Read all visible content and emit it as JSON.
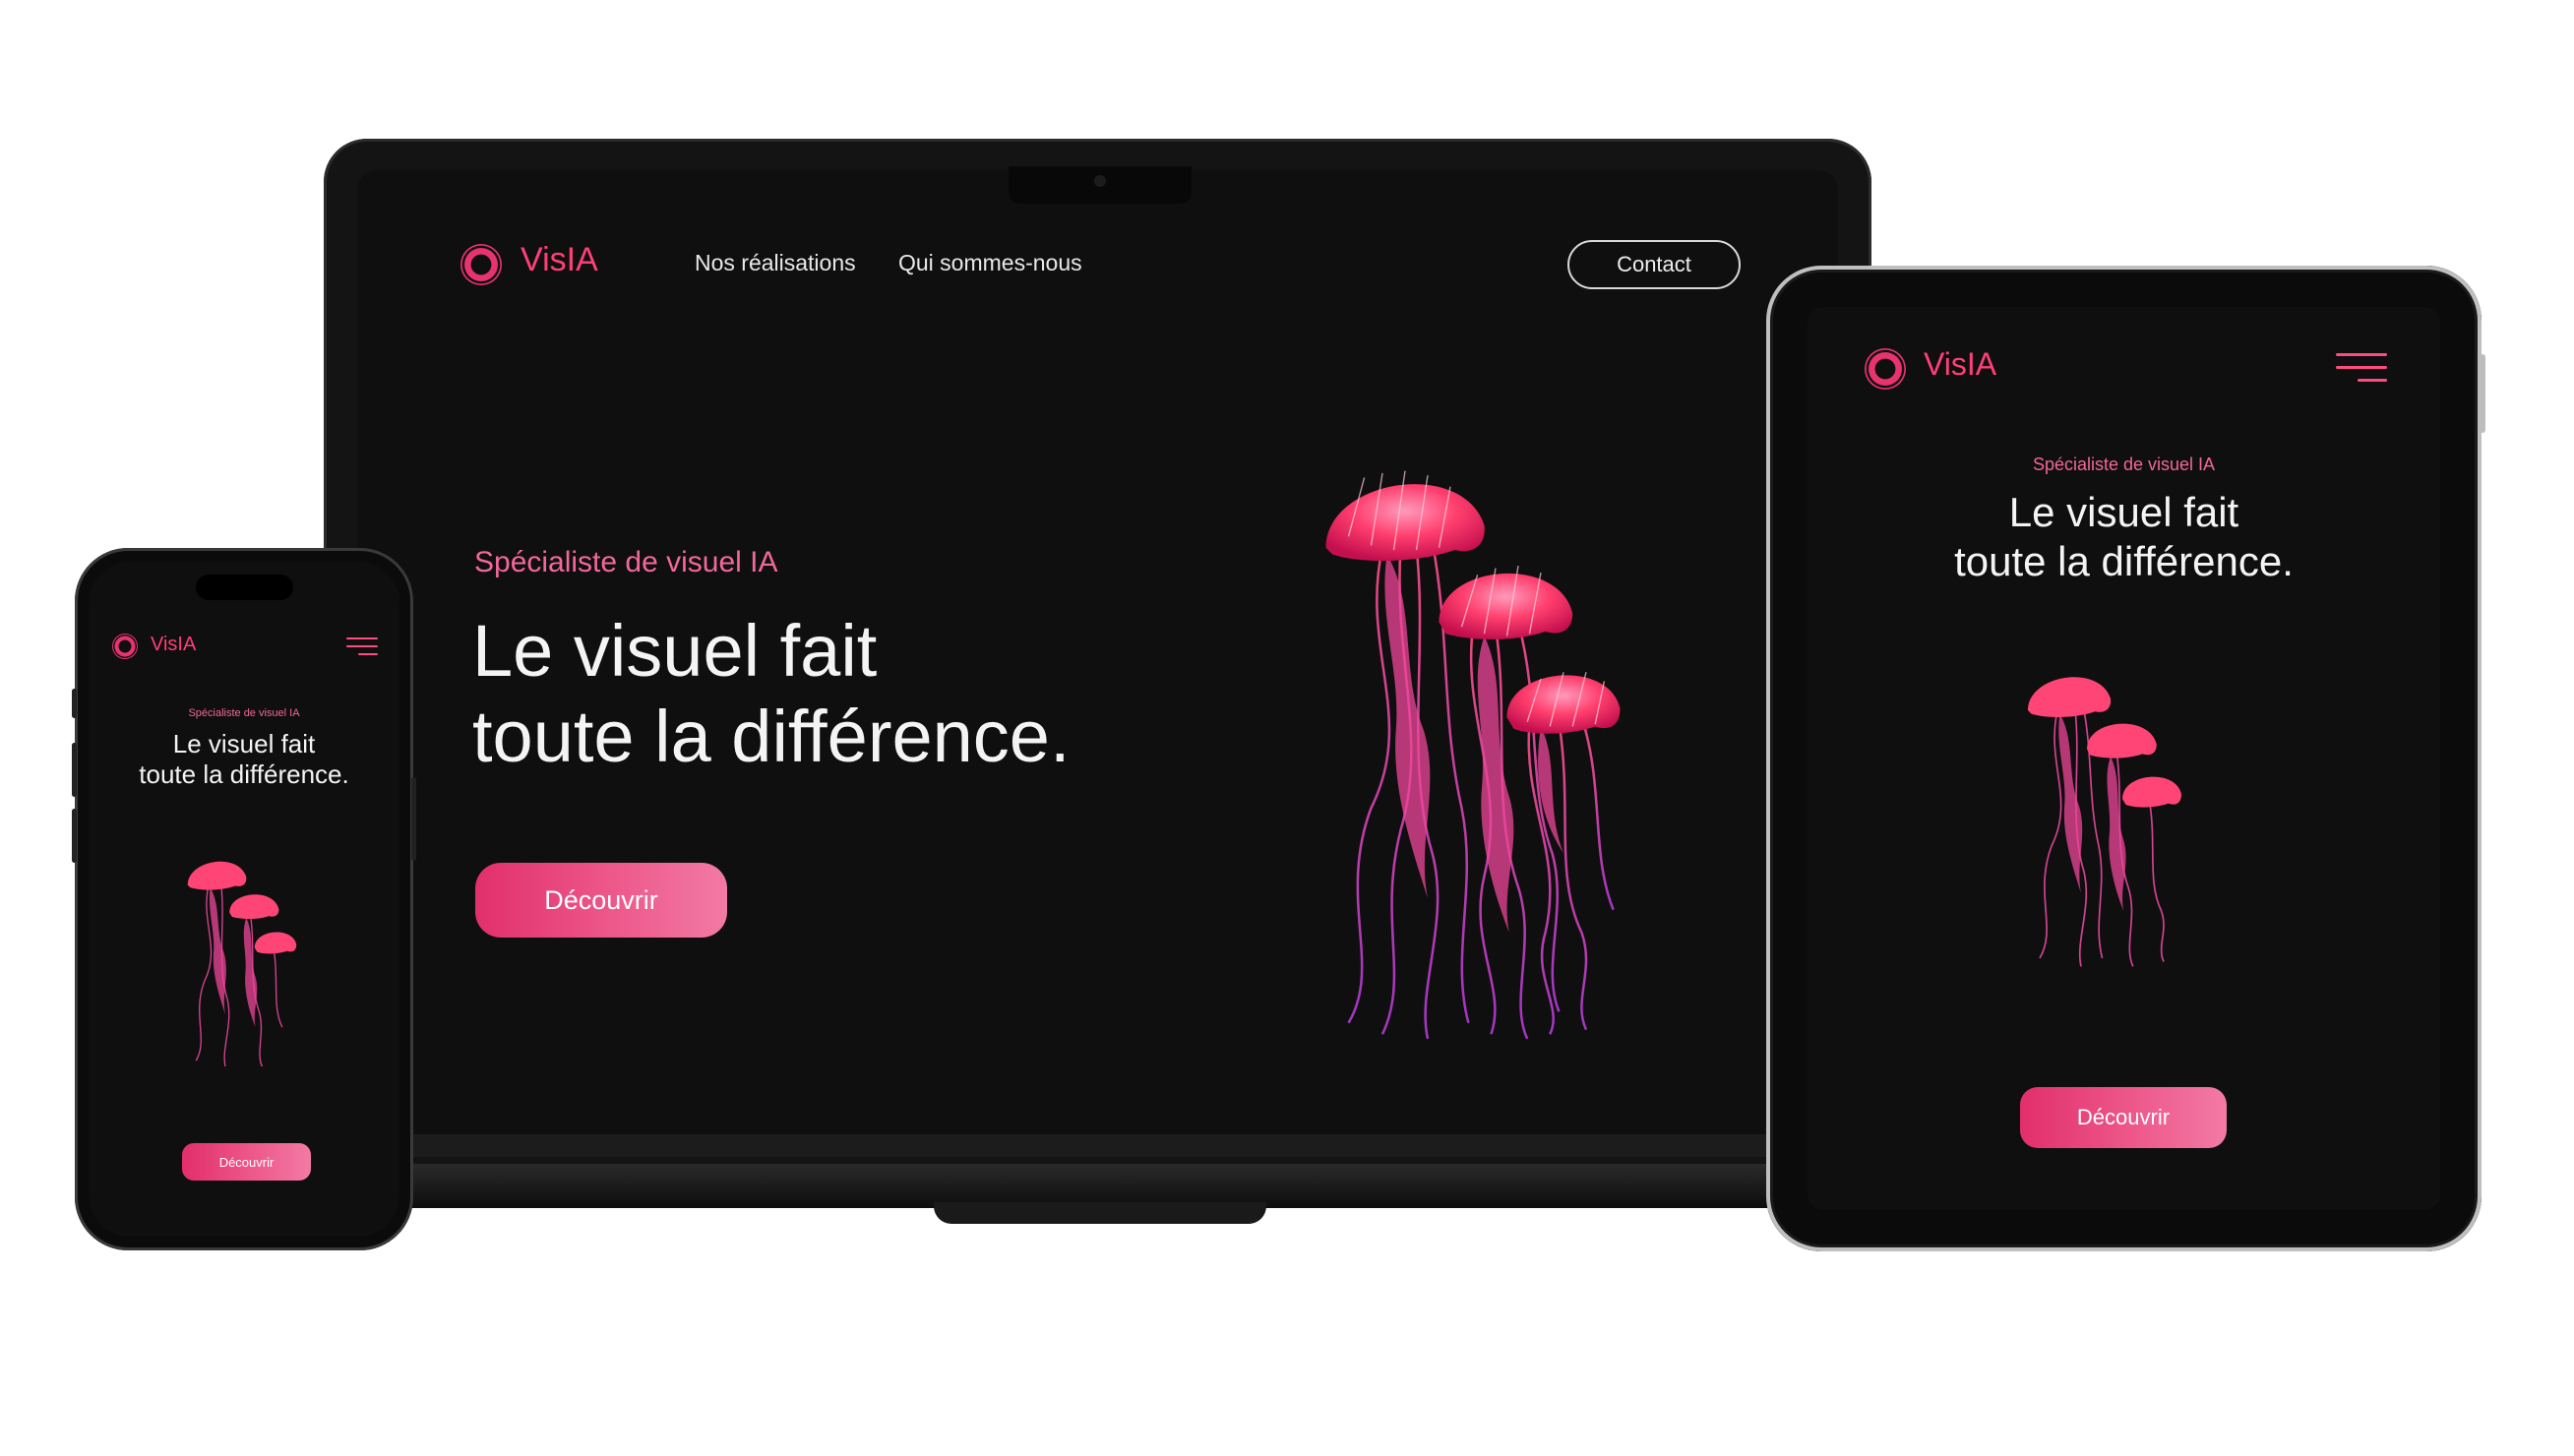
{
  "brand": {
    "name": "VisIA",
    "accent": "#e8336f"
  },
  "nav": {
    "links": [
      "Nos réalisations",
      "Qui sommes-nous"
    ],
    "contact": "Contact"
  },
  "hero": {
    "kicker": "Spécialiste de visuel IA",
    "headline_line1": "Le visuel fait",
    "headline_line2": "toute la différence.",
    "cta": "Découvrir"
  },
  "icons": {
    "menu": "hamburger-menu-icon",
    "logo": "ring-logo-icon",
    "hero": "jellyfish-illustration"
  }
}
